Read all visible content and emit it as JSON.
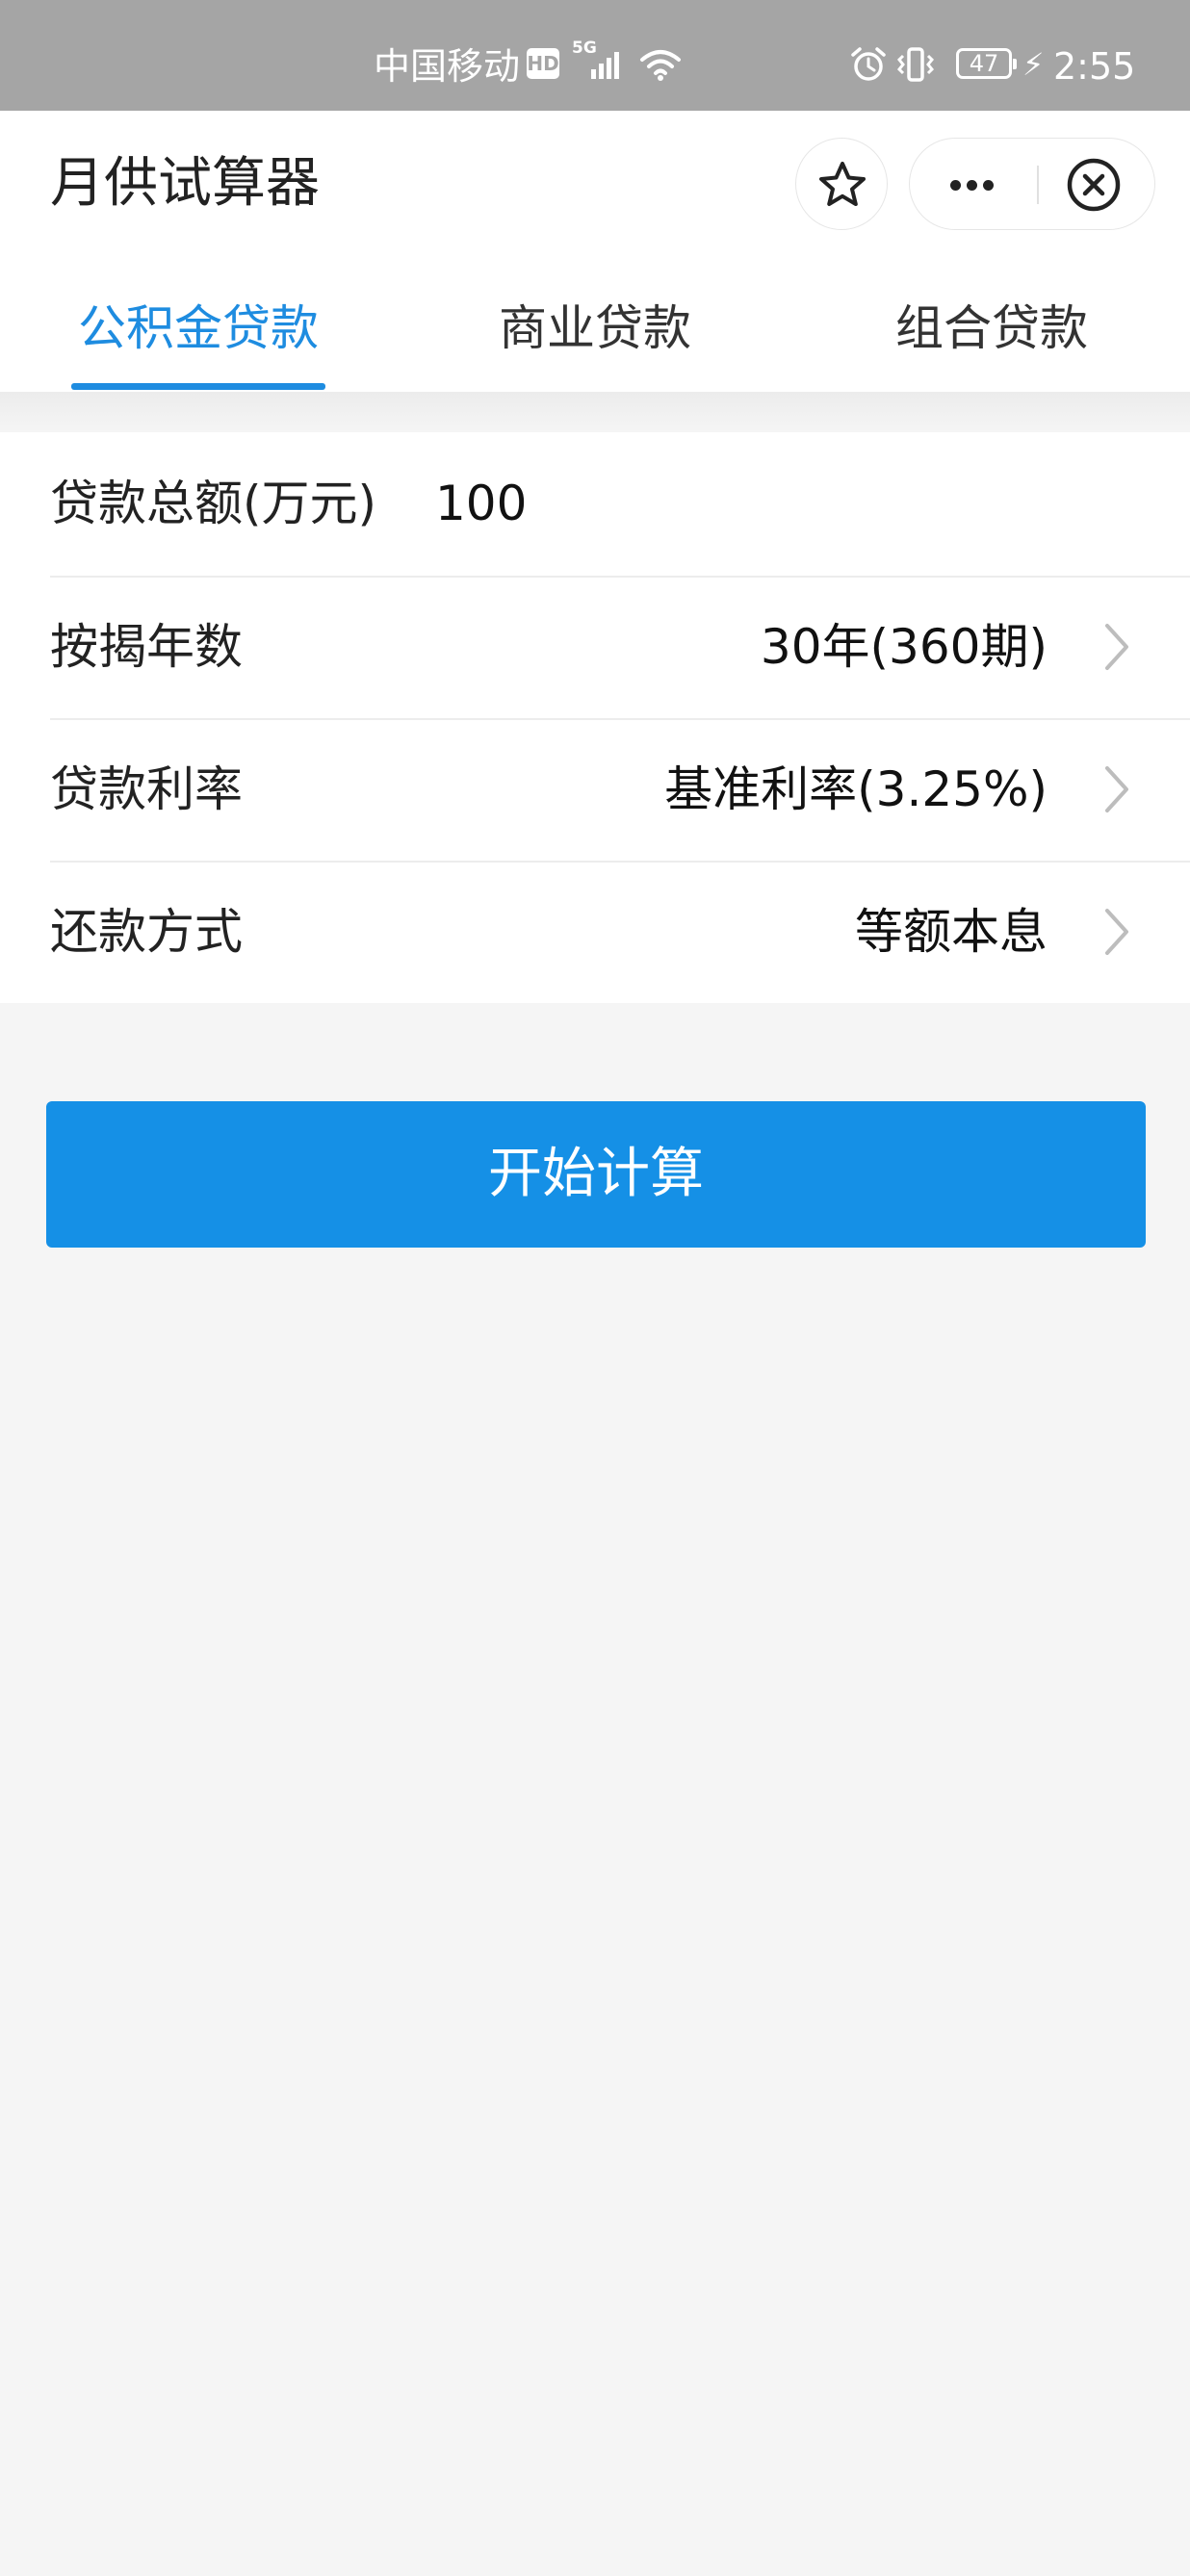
{
  "status_bar": {
    "carrier": "中国移动",
    "hd_badge": "HD",
    "network": "5G",
    "battery": "47",
    "time": "2:55",
    "icons": [
      "signal-icon",
      "wifi-icon",
      "alarm-icon",
      "vibrate-icon",
      "battery-icon",
      "charging-icon"
    ]
  },
  "header": {
    "title": "月供试算器",
    "favorite_icon": "star-icon",
    "more_icon": "more-dots-icon",
    "close_icon": "close-circle-icon"
  },
  "tabs": [
    {
      "label": "公积金贷款",
      "active": true
    },
    {
      "label": "商业贷款",
      "active": false
    },
    {
      "label": "组合贷款",
      "active": false
    }
  ],
  "form": {
    "amount": {
      "label": "贷款总额(万元)",
      "value": "100"
    },
    "years": {
      "label": "按揭年数",
      "value": "30年(360期)"
    },
    "rate": {
      "label": "贷款利率",
      "value": "基准利率(3.25%)"
    },
    "method": {
      "label": "还款方式",
      "value": "等额本息"
    }
  },
  "calculate_button": "开始计算",
  "colors": {
    "accent": "#1e8ce0",
    "button": "#1590e6",
    "status_bar": "#a5a5a5",
    "page_background": "#f5f5f5"
  }
}
